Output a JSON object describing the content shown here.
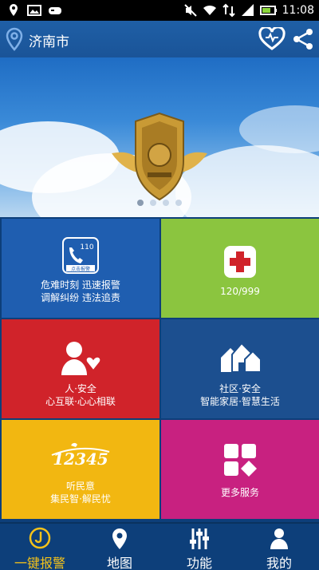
{
  "status_bar": {
    "time": "11:08",
    "icons": [
      "location-icon",
      "image-icon",
      "gamepad-icon",
      "mute-icon",
      "wifi-icon",
      "data-icon",
      "signal-icon",
      "battery-icon"
    ]
  },
  "header": {
    "city": "济南市",
    "icons": [
      "location-pin-icon",
      "heart-icon",
      "share-icon"
    ]
  },
  "banner": {
    "slides_count": 4,
    "active_slide": 1,
    "colors": {
      "sky_top": "#1f6dc4",
      "sky_bottom": "#b9d7f1"
    }
  },
  "tiles": [
    {
      "id": "emergency",
      "icon": "phone-110-icon",
      "line1": "危难时刻  迅速报警",
      "line2": "调解纠纷  违法追责",
      "color": "#1f5eb0",
      "icon_text": "110",
      "icon_subtext": "点击报警"
    },
    {
      "id": "medical",
      "icon": "red-cross-icon",
      "line1": "120/999",
      "color": "#8bc53f"
    },
    {
      "id": "safety",
      "icon": "person-heart-icon",
      "line1": "人·安全",
      "line2": "心互联·心心相联",
      "color": "#d0232a"
    },
    {
      "id": "community",
      "icon": "houses-icon",
      "line1": "社区·安全",
      "line2": "智能家居·智慧生活",
      "color": "#1c4f8f"
    },
    {
      "id": "hotline",
      "icon": "hotline-12345-icon",
      "icon_text": "12345",
      "line1": "听民意",
      "line2": "集民智·解民忧",
      "color": "#f2b711"
    },
    {
      "id": "more",
      "icon": "grid-icon",
      "line1": "更多服务",
      "color": "#c82180"
    }
  ],
  "bottom_nav": {
    "items": [
      {
        "label": "一键报警",
        "icon": "alarm-icon",
        "active": true
      },
      {
        "label": "地图",
        "icon": "map-pin-icon",
        "active": false
      },
      {
        "label": "功能",
        "icon": "sliders-icon",
        "active": false
      },
      {
        "label": "我的",
        "icon": "user-icon",
        "active": false
      }
    ],
    "colors": {
      "active": "#f4c21a",
      "inactive": "#ffffff"
    }
  }
}
